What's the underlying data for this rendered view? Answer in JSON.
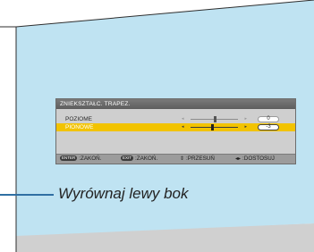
{
  "colors": {
    "screen_fill": "#bfe3f2",
    "screen_outline": "#2e2e2e",
    "lower_band": "#d0d0d0",
    "highlight": "#f2c300",
    "callout_line": "#2f6fa3"
  },
  "osd": {
    "title": "ZNIEKSZTAŁC. TRAPEZ.",
    "rows": [
      {
        "label": "POZIOME",
        "value": "0",
        "level": 0.5,
        "selected": false
      },
      {
        "label": "PIONOWE",
        "value": "-3",
        "level": 0.45,
        "selected": true
      }
    ],
    "footer": [
      {
        "key": "ENTER",
        "text": ":ZAKOŃ."
      },
      {
        "key": "EXIT",
        "text": ":ZAKOŃ."
      },
      {
        "symbol": "⇕",
        "text": ":PRZESUŃ"
      },
      {
        "symbol": "◂▸",
        "text": ":DOSTOSUJ"
      }
    ]
  },
  "callout": {
    "text": "Wyrównaj lewy bok"
  }
}
